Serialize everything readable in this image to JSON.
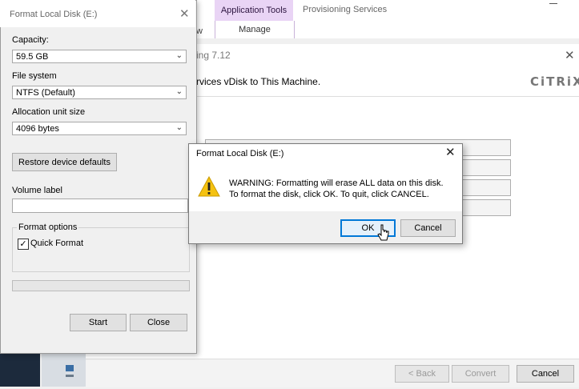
{
  "explorer": {
    "context_tab": "Application Tools",
    "tab_provisioning": "Provisioning Services",
    "ribbon_manage": "Manage",
    "ribbon_view_fragment": "w"
  },
  "wizard": {
    "title_fragment": "ing 7.12",
    "heading": "rvices vDisk to This Machine.",
    "logo_text": "CiTRiX",
    "buttons": {
      "back": "< Back",
      "convert": "Convert",
      "cancel": "Cancel"
    }
  },
  "format_dialog": {
    "title": "Format Local Disk (E:)",
    "capacity_label": "Capacity:",
    "capacity_value": "59.5 GB",
    "filesystem_label": "File system",
    "filesystem_value": "NTFS (Default)",
    "allocation_label": "Allocation unit size",
    "allocation_value": "4096 bytes",
    "restore_button": "Restore device defaults",
    "volume_label": "Volume label",
    "volume_value": "",
    "format_options_label": "Format options",
    "quick_format_label": "Quick Format",
    "quick_format_checked": true,
    "progress": 0,
    "start_button": "Start",
    "close_button": "Close"
  },
  "warning_dialog": {
    "title": "Format Local Disk (E:)",
    "line1": "WARNING: Formatting will erase ALL data on this disk.",
    "line2": "To format the disk, click OK. To quit, click CANCEL.",
    "ok_button": "OK",
    "cancel_button": "Cancel",
    "icon": "warning-icon"
  },
  "colors": {
    "context_tab_bg": "#e9d4f5",
    "warning_yellow": "#f5c211",
    "focus_blue": "#0078d7"
  }
}
